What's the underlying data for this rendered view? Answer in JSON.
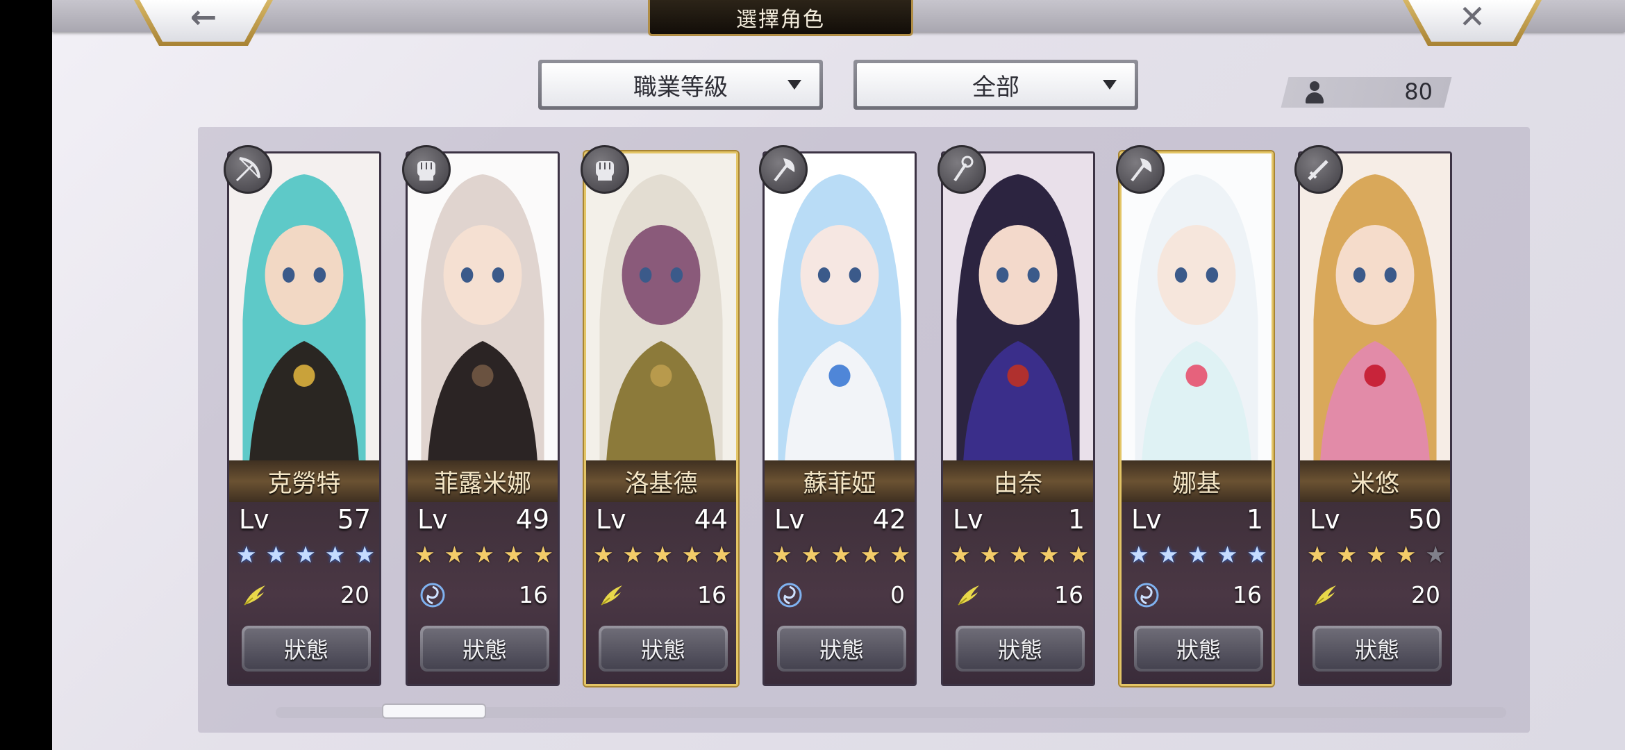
{
  "header": {
    "title": "選擇角色",
    "back_label": "←",
    "close_label": "✕"
  },
  "toolbar": {
    "sort": {
      "selected": "職業等級"
    },
    "filter": {
      "selected": "全部"
    },
    "unit_count": "80"
  },
  "characters": [
    {
      "name": "克勞特",
      "lv_label": "Lv",
      "level": "57",
      "stars": 5,
      "star_color": "blue",
      "element_icon": "wind-wing-icon",
      "cost": "20",
      "status_label": "狀態",
      "class_icon": "bow-icon",
      "selected": false,
      "colors": {
        "hair": "#5ec9c8",
        "skin": "#f2d8c4",
        "outfit": "#2a2622",
        "bg": "#f4f0ef",
        "accent": "#c9a23a"
      }
    },
    {
      "name": "菲露米娜",
      "lv_label": "Lv",
      "level": "49",
      "stars": 5,
      "star_color": "gold",
      "element_icon": "water-swirl-icon",
      "cost": "16",
      "status_label": "狀態",
      "class_icon": "fist-icon",
      "selected": false,
      "colors": {
        "hair": "#e0d4cf",
        "skin": "#f5e0d2",
        "outfit": "#2b2424",
        "bg": "#fbfafa",
        "accent": "#6a5240"
      }
    },
    {
      "name": "洛基德",
      "lv_label": "Lv",
      "level": "44",
      "stars": 5,
      "star_color": "gold",
      "element_icon": "wind-wing-icon",
      "cost": "16",
      "status_label": "狀態",
      "class_icon": "fist-icon",
      "selected": true,
      "colors": {
        "hair": "#e3ddd2",
        "skin": "#8a5a7a",
        "outfit": "#8c7a3a",
        "bg": "#f3f0e9",
        "accent": "#b89a4c"
      }
    },
    {
      "name": "蘇菲婭",
      "lv_label": "Lv",
      "level": "42",
      "stars": 5,
      "star_color": "gold",
      "element_icon": "water-swirl-icon",
      "cost": "0",
      "status_label": "狀態",
      "class_icon": "axe-icon",
      "selected": false,
      "colors": {
        "hair": "#b9dcf6",
        "skin": "#f6e7e2",
        "outfit": "#f2f4f8",
        "bg": "#ffffff",
        "accent": "#4f86d8"
      }
    },
    {
      "name": "由奈",
      "lv_label": "Lv",
      "level": "1",
      "stars": 5,
      "star_color": "gold",
      "element_icon": "wind-wing-icon",
      "cost": "16",
      "status_label": "狀態",
      "class_icon": "staff-icon",
      "selected": false,
      "colors": {
        "hair": "#2c2440",
        "skin": "#f3d9cb",
        "outfit": "#3a2e8a",
        "bg": "#e9e0ea",
        "accent": "#b0302e"
      }
    },
    {
      "name": "娜基",
      "lv_label": "Lv",
      "level": "1",
      "stars": 5,
      "star_color": "blue",
      "element_icon": "water-swirl-icon",
      "cost": "16",
      "status_label": "狀態",
      "class_icon": "axe-icon",
      "selected": true,
      "colors": {
        "hair": "#eef3f7",
        "skin": "#f6e6dc",
        "outfit": "#dff2f4",
        "bg": "#fbfcfd",
        "accent": "#e6627c"
      }
    },
    {
      "name": "米悠",
      "lv_label": "Lv",
      "level": "50",
      "stars": 4,
      "star_color": "gold",
      "element_icon": "wind-wing-icon",
      "cost": "20",
      "status_label": "狀態",
      "class_icon": "sword-icon",
      "selected": false,
      "colors": {
        "hair": "#d9a85a",
        "skin": "#f5dccb",
        "outfit": "#e28ba8",
        "bg": "#f6ede6",
        "accent": "#c8243a"
      }
    }
  ]
}
